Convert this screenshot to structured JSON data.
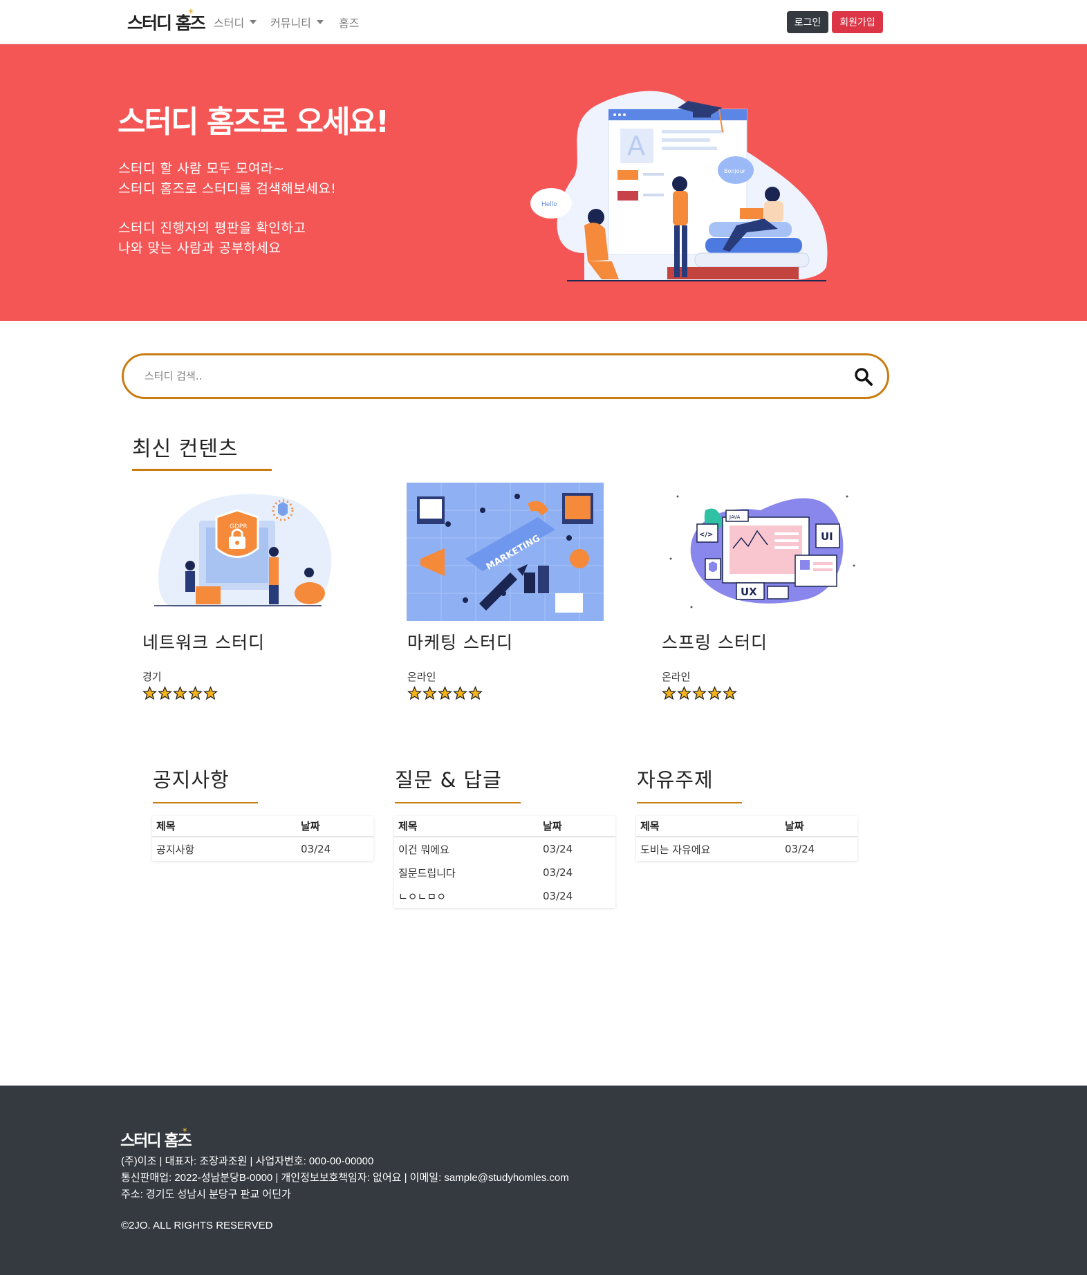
{
  "nav": {
    "brand": "스터디 홈즈",
    "items": [
      {
        "label": "스터디",
        "dropdown": true
      },
      {
        "label": "커뮤니티",
        "dropdown": true
      },
      {
        "label": "홈즈",
        "dropdown": false
      }
    ],
    "login": "로그인",
    "signup": "회원가입"
  },
  "hero": {
    "title": "스터디 홈즈로 오세요!",
    "lines": [
      "스터디 할 사람 모두 모여라~",
      "스터디 홈즈로 스터디를 검색해보세요!",
      "스터디 진행자의 평판을 확인하고",
      "나와 맞는 사람과 공부하세요"
    ],
    "bubble_left": "Hello",
    "bubble_right": "Bonjour",
    "background": "#f45656"
  },
  "search": {
    "placeholder": "스터디 검색..",
    "accent": "#c97c11"
  },
  "latest": {
    "title": "최신 컨텐츠",
    "cards": [
      {
        "title": "네트워크 스터디",
        "location": "경기",
        "rating": 5,
        "image": "gdpr-security-illustration",
        "image_text": "GDPR"
      },
      {
        "title": "마케팅 스터디",
        "location": "온라인",
        "rating": 5,
        "image": "marketing-isometric-illustration",
        "image_text": "MARKETING"
      },
      {
        "title": "스프링 스터디",
        "location": "온라인",
        "rating": 5,
        "image": "ui-ux-illustration",
        "image_text": [
          "UI",
          "UX",
          "JAVA",
          "</>"
        ]
      }
    ]
  },
  "boards": [
    {
      "title": "공지사항",
      "col_title": "제목",
      "col_date": "날짜",
      "rows": [
        {
          "title": "공지사항",
          "date": "03/24"
        }
      ]
    },
    {
      "title": "질문 & 답글",
      "col_title": "제목",
      "col_date": "날짜",
      "rows": [
        {
          "title": "이건 뭐에요",
          "date": "03/24"
        },
        {
          "title": "질문드립니다",
          "date": "03/24"
        },
        {
          "title": "ㄴㅇㄴㅁㅇ",
          "date": "03/24"
        }
      ]
    },
    {
      "title": "자유주제",
      "col_title": "제목",
      "col_date": "날짜",
      "rows": [
        {
          "title": "도비는 자유에요",
          "date": "03/24"
        }
      ]
    }
  ],
  "footer": {
    "brand": "스터디 홈즈",
    "line1": "(주)이조 | 대표자: 조장과조원 | 사업자번호: 000-00-00000",
    "line2": "통신판매업: 2022-성남분당B-0000 | 개인정보보호책임자: 없어요 | 이메일: sample@studyhomles.com",
    "line3": "주소: 경기도 성남시 분당구 판교 어딘가",
    "copyright": "©2JO. ALL RIGHTS RESERVED"
  },
  "colors": {
    "accent": "#c97c11",
    "danger": "#dc3545",
    "dark": "#343a40",
    "star": "#f5b31b"
  }
}
